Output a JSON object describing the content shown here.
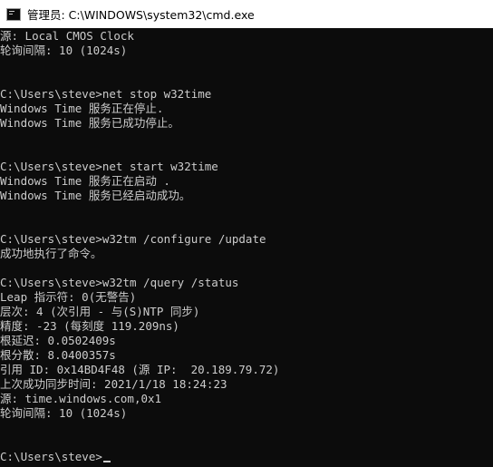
{
  "window": {
    "title": "管理员: C:\\WINDOWS\\system32\\cmd.exe",
    "icon": "cmd-icon"
  },
  "console": {
    "lines": [
      "源: Local CMOS Clock",
      "轮询间隔: 10 (1024s)",
      "",
      "",
      "C:\\Users\\steve>net stop w32time",
      "Windows Time 服务正在停止.",
      "Windows Time 服务已成功停止。",
      "",
      "",
      "C:\\Users\\steve>net start w32time",
      "Windows Time 服务正在启动 .",
      "Windows Time 服务已经启动成功。",
      "",
      "",
      "C:\\Users\\steve>w32tm /configure /update",
      "成功地执行了命令。",
      "",
      "C:\\Users\\steve>w32tm /query /status",
      "Leap 指示符: 0(无警告)",
      "层次: 4 (次引用 - 与(S)NTP 同步)",
      "精度: -23 (每刻度 119.209ns)",
      "根延迟: 0.0502409s",
      "根分散: 8.0400357s",
      "引用 ID: 0x14BD4F48 (源 IP:  20.189.79.72)",
      "上次成功同步时间: 2021/1/18 18:24:23",
      "源: time.windows.com,0x1",
      "轮询间隔: 10 (1024s)",
      "",
      "",
      "C:\\Users\\steve>"
    ]
  }
}
